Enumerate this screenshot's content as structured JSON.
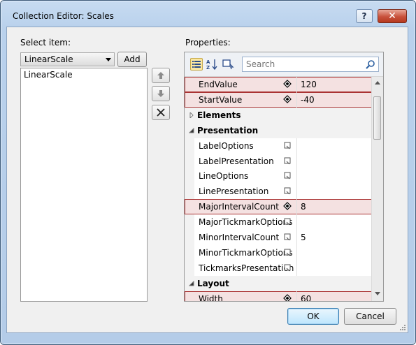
{
  "window": {
    "title": "Collection Editor: Scales",
    "help_label": "?",
    "close_label": "✕"
  },
  "left": {
    "select_label": "Select item:",
    "combo_value": "LinearScale",
    "add_label": "Add",
    "list_items": [
      "LinearScale"
    ]
  },
  "right": {
    "properties_label": "Properties:",
    "search_placeholder": "Search",
    "rows": [
      {
        "kind": "prop",
        "name": "EndValue",
        "value": "120",
        "marker": "diamond",
        "highlight": true
      },
      {
        "kind": "prop",
        "name": "StartValue",
        "value": "-40",
        "marker": "diamond",
        "highlight": true
      },
      {
        "kind": "cat",
        "name": "Elements",
        "expanded": false
      },
      {
        "kind": "cat",
        "name": "Presentation",
        "expanded": true
      },
      {
        "kind": "prop",
        "name": "LabelOptions",
        "value": "",
        "marker": "square",
        "highlight": false
      },
      {
        "kind": "prop",
        "name": "LabelPresentation",
        "value": "",
        "marker": "square",
        "highlight": false
      },
      {
        "kind": "prop",
        "name": "LineOptions",
        "value": "",
        "marker": "square",
        "highlight": false
      },
      {
        "kind": "prop",
        "name": "LinePresentation",
        "value": "",
        "marker": "square",
        "highlight": false
      },
      {
        "kind": "prop",
        "name": "MajorIntervalCount",
        "value": "8",
        "marker": "diamond",
        "highlight": true
      },
      {
        "kind": "prop",
        "name": "MajorTickmarkOptions",
        "value": "",
        "marker": "square",
        "highlight": false
      },
      {
        "kind": "prop",
        "name": "MinorIntervalCount",
        "value": "5",
        "marker": "square",
        "highlight": false
      },
      {
        "kind": "prop",
        "name": "MinorTickmarkOptions",
        "value": "",
        "marker": "square",
        "highlight": false
      },
      {
        "kind": "prop",
        "name": "TickmarksPresentation",
        "value": "",
        "marker": "square",
        "highlight": false
      },
      {
        "kind": "cat",
        "name": "Layout",
        "expanded": true
      },
      {
        "kind": "prop",
        "name": "Width",
        "value": "60",
        "marker": "diamond",
        "highlight": true
      }
    ]
  },
  "buttons": {
    "ok": "OK",
    "cancel": "Cancel"
  },
  "colors": {
    "highlight_fill": "#f4e1e1",
    "highlight_border": "#aa3333",
    "ok_border": "#3c7fb1"
  }
}
